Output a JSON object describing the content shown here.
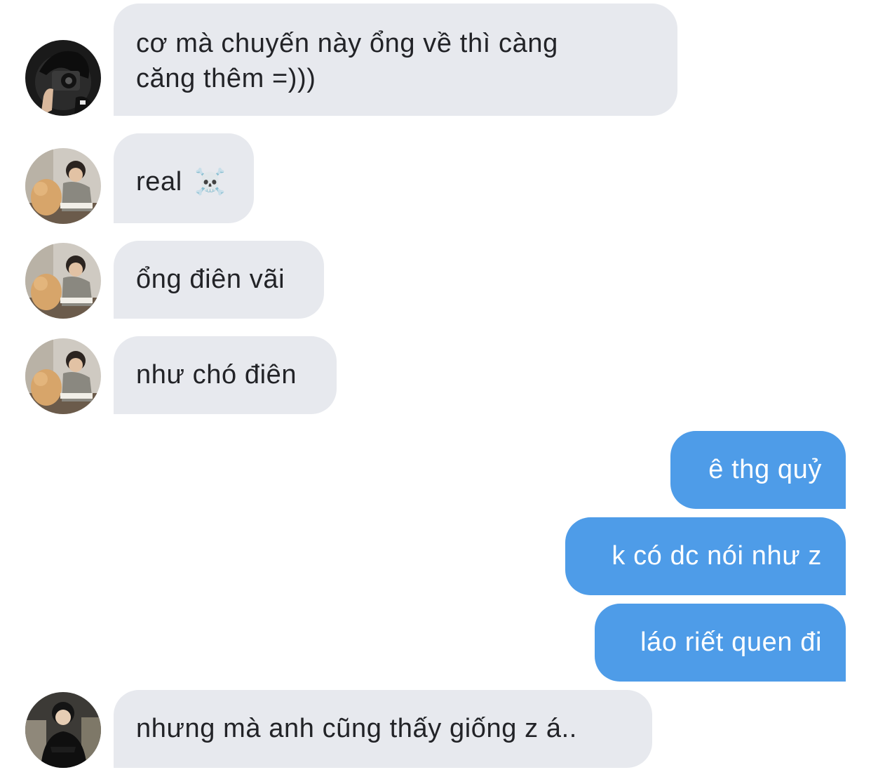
{
  "messages": [
    {
      "sender": "friend1",
      "direction": "in",
      "lines": [
        "cơ mà chuyến này ổng về thì càng",
        "căng thêm =)))"
      ]
    },
    {
      "sender": "friend2",
      "direction": "in",
      "text": "real",
      "emoji": "☠️"
    },
    {
      "sender": "friend2",
      "direction": "in",
      "text": "ổng điên vãi"
    },
    {
      "sender": "friend2",
      "direction": "in",
      "text": "như chó điên"
    },
    {
      "sender": "me",
      "direction": "out",
      "text": "ê thg quỷ"
    },
    {
      "sender": "me",
      "direction": "out",
      "text": "k có dc nói như z"
    },
    {
      "sender": "me",
      "direction": "out",
      "text": "láo riết quen đi"
    },
    {
      "sender": "friend3",
      "direction": "in",
      "text": "nhưng mà anh cũng thấy giống z á.."
    }
  ],
  "colors": {
    "incoming_bubble": "#e7e9ee",
    "incoming_text": "#222327",
    "outgoing_bubble": "#4e9ce8",
    "outgoing_text": "#ffffff",
    "background": "#ffffff"
  },
  "avatars": {
    "friend1": "camera-photographer-avatar",
    "friend2": "person-with-cat-avatar",
    "friend3": "person-in-black-avatar"
  }
}
